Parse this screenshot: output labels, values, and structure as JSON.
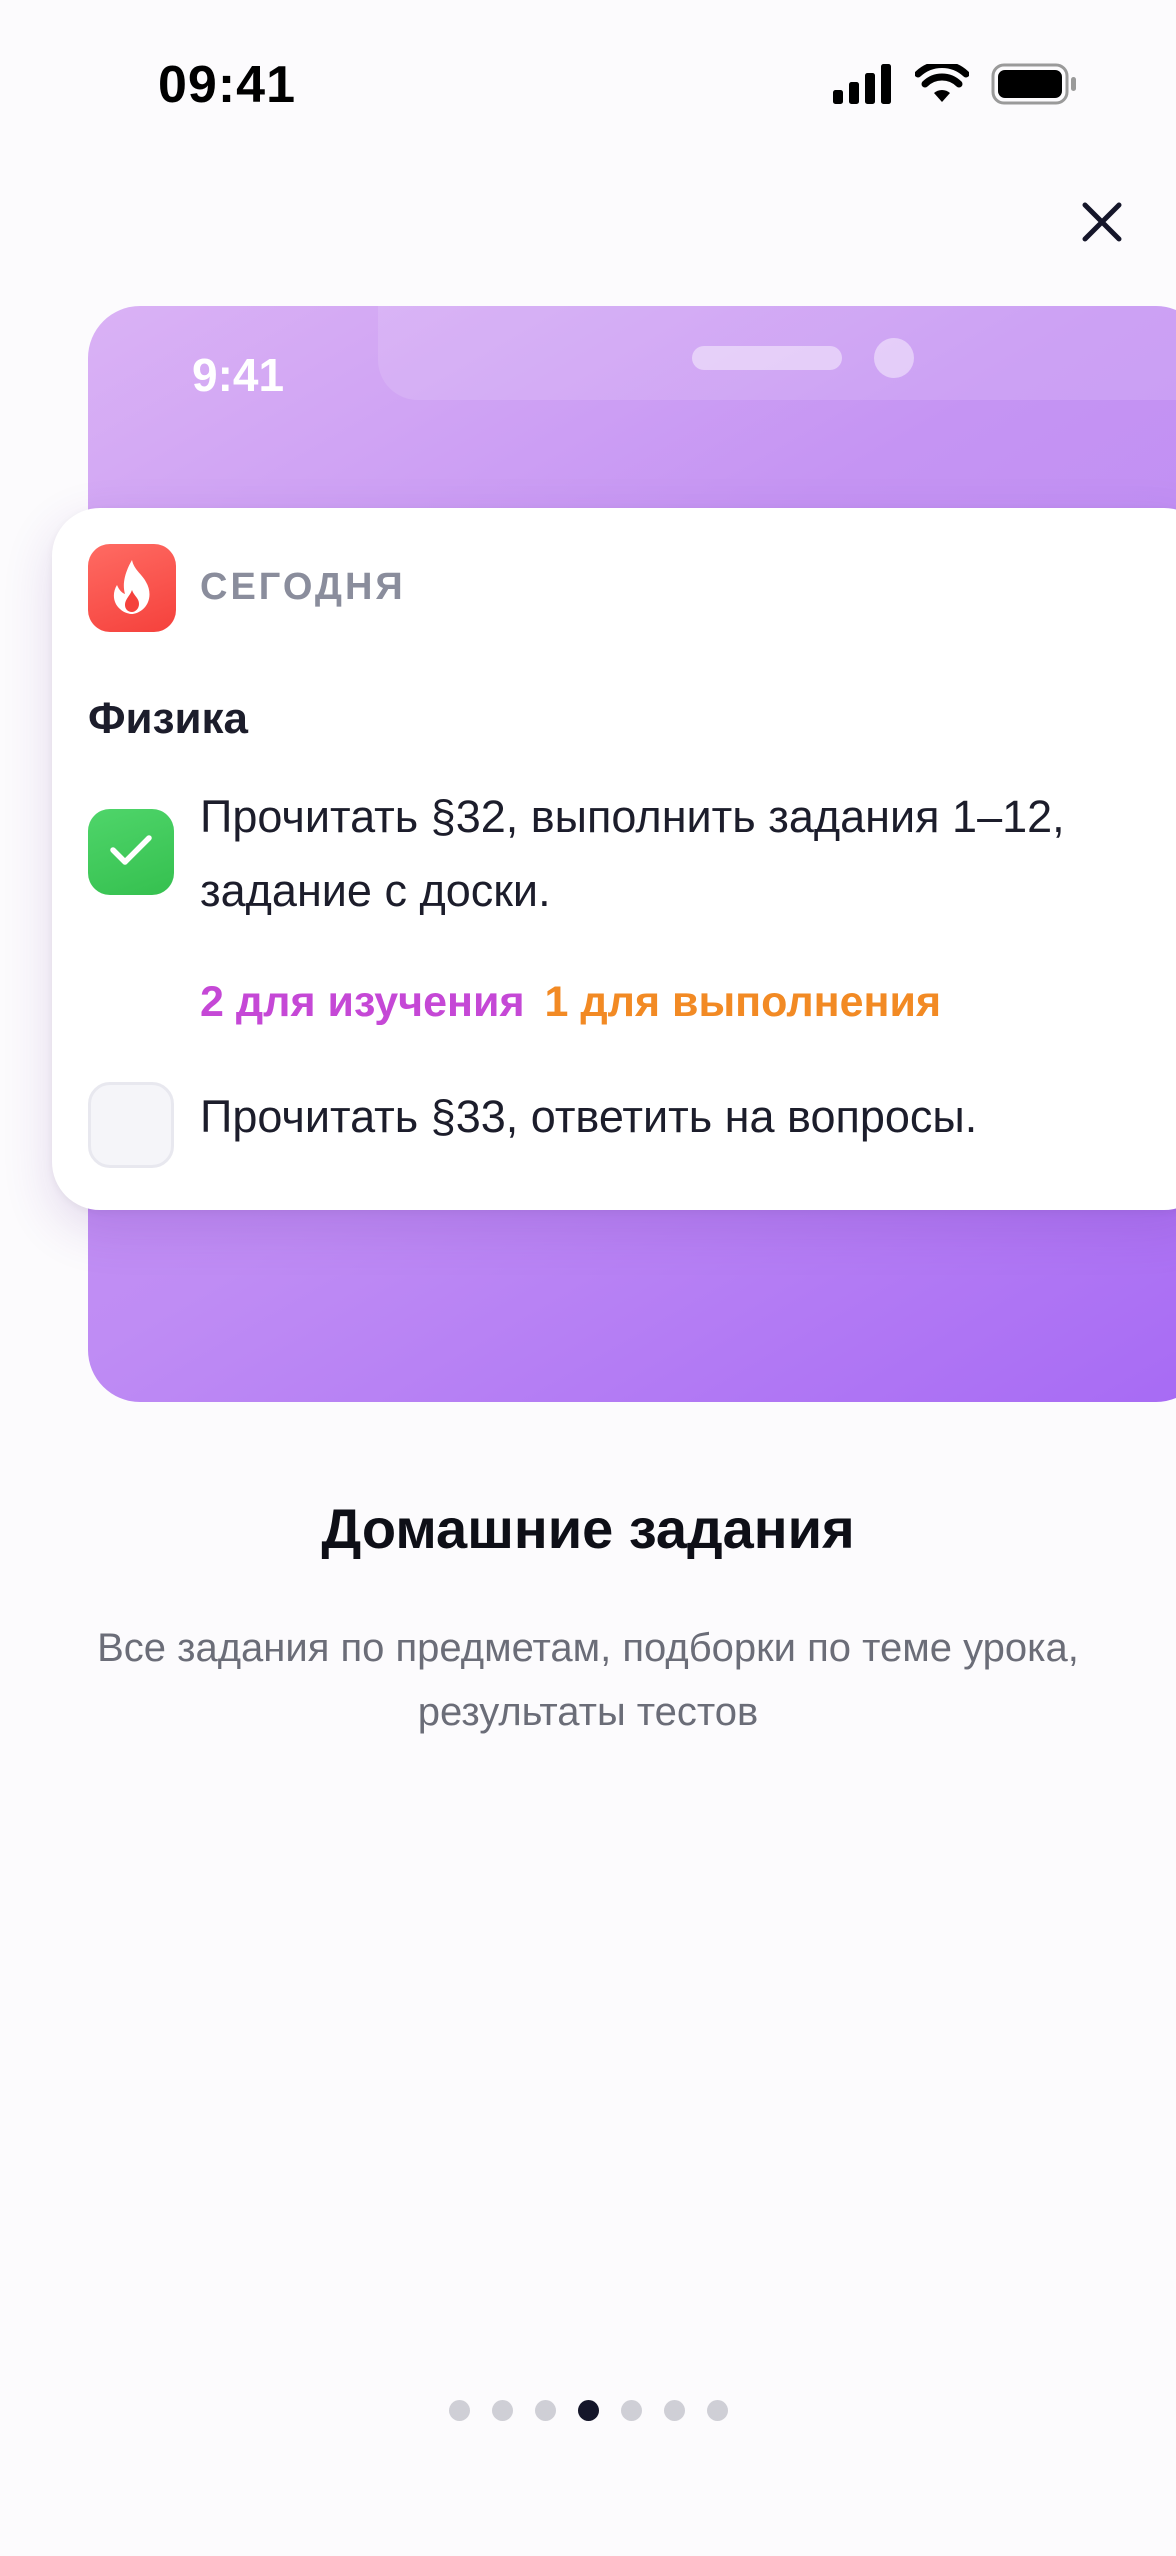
{
  "status_bar": {
    "time": "09:41",
    "icons": [
      "cellular-signal-icon",
      "wifi-icon",
      "battery-icon"
    ]
  },
  "preview": {
    "time": "9:41"
  },
  "homework_card": {
    "section_label": "СЕГОДНЯ",
    "subject": "Физика",
    "tasks": [
      {
        "text": "Прочитать §32, выполнить задания 1–12, задание с доски.",
        "done": true,
        "tag_study": "2 для изучения",
        "tag_do": "1 для выполнения"
      },
      {
        "text": "Прочитать §33, ответить на вопросы.",
        "done": false
      }
    ]
  },
  "onboarding": {
    "title": "Домашние задания",
    "subtitle": "Все задания по предметам, подборки по теме урока, результаты тестов"
  },
  "pager": {
    "total": 7,
    "active_index": 3
  },
  "colors": {
    "accent_purple": "#a76af4",
    "badge_red": "#f5413c",
    "check_green": "#35c04f",
    "tag_study": "#c548d6",
    "tag_do": "#f28a24"
  }
}
